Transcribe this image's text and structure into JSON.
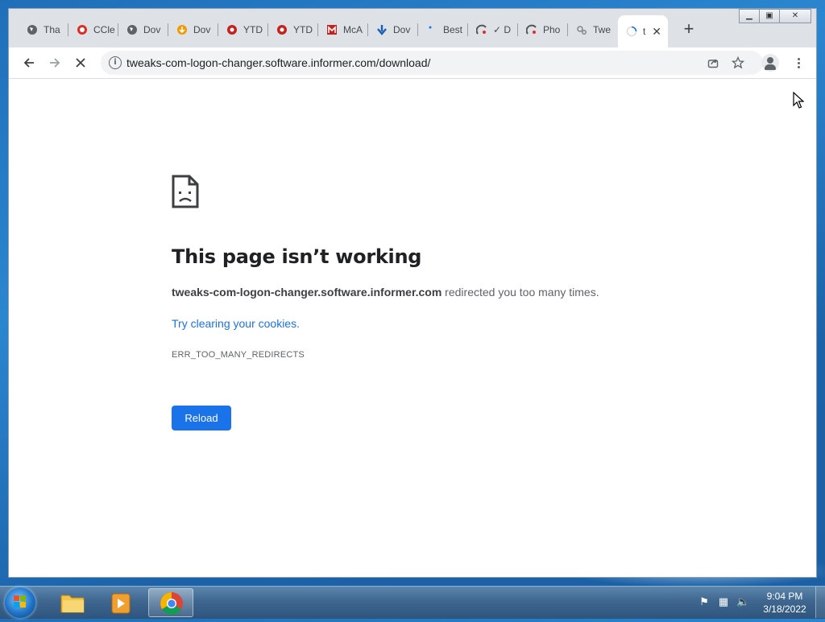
{
  "browser": {
    "tabs": [
      {
        "label": "Tha",
        "icon": "globe-icon"
      },
      {
        "label": "CCle",
        "icon": "ccleaner-icon"
      },
      {
        "label": "Dov",
        "icon": "globe-icon"
      },
      {
        "label": "Dov",
        "icon": "download-logo-icon"
      },
      {
        "label": "YTD",
        "icon": "ytd-icon"
      },
      {
        "label": "YTD",
        "icon": "ytd-icon"
      },
      {
        "label": "McA",
        "icon": "mcafee-icon"
      },
      {
        "label": "Dov",
        "icon": "download-arrow-icon"
      },
      {
        "label": "Best",
        "icon": "dot-icon"
      },
      {
        "label": "✓ D",
        "icon": "softpedia-icon"
      },
      {
        "label": "Pho",
        "icon": "softpedia-icon"
      },
      {
        "label": "Twe",
        "icon": "gears-icon"
      },
      {
        "label": "t",
        "icon": "loading-spinner-icon",
        "active": true
      }
    ],
    "url": "tweaks-com-logon-changer.software.informer.com/download/"
  },
  "error_page": {
    "title": "This page isn’t working",
    "host": "tweaks-com-logon-changer.software.informer.com",
    "desc_suffix": " redirected you too many times.",
    "link_text": "Try clearing your cookies.",
    "error_code": "ERR_TOO_MANY_REDIRECTS",
    "reload_label": "Reload"
  },
  "taskbar": {
    "time": "9:04 PM",
    "date": "3/18/2022"
  },
  "colors": {
    "accent": "#1a73e8",
    "desktop": "#1f6fb8"
  }
}
